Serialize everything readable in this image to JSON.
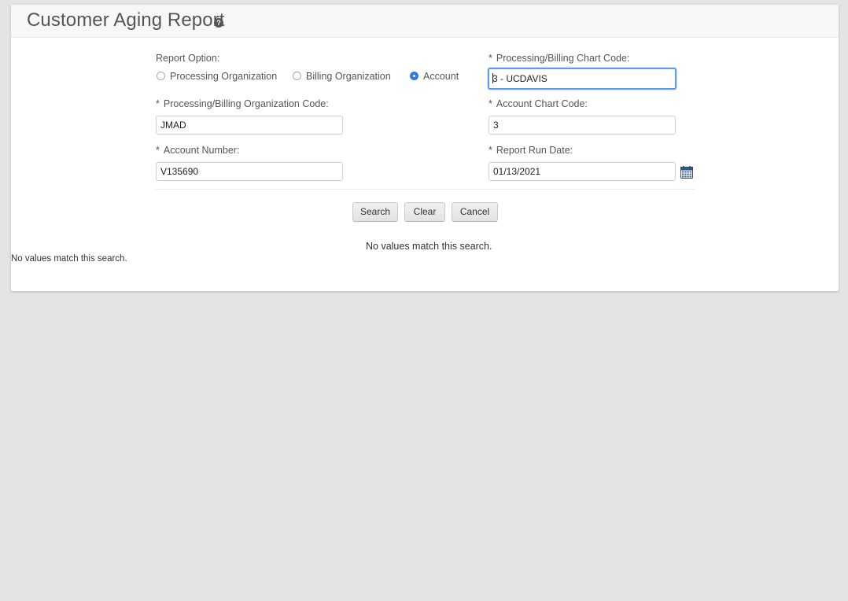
{
  "header": {
    "title": "Customer Aging Report",
    "help_icon": "help-icon",
    "help_glyph": "?"
  },
  "report_option": {
    "label": "Report Option:",
    "options": [
      {
        "label": "Processing Organization",
        "checked": false
      },
      {
        "label": "Billing Organization",
        "checked": false
      },
      {
        "label": "Account",
        "checked": true
      }
    ]
  },
  "fields": {
    "required_marker": "*",
    "processing_chart_code": {
      "label": "Processing/Billing Chart Code:",
      "value": "3 - UCDAVIS"
    },
    "processing_org_code": {
      "label": "Processing/Billing Organization Code:",
      "value": "JMAD"
    },
    "account_chart_code": {
      "label": "Account Chart Code:",
      "value": "3"
    },
    "account_number": {
      "label": "Account Number:",
      "value": "V135690"
    },
    "report_run_date": {
      "label": "Report Run Date:",
      "value": "01/13/2021",
      "icon": "calendar-icon"
    }
  },
  "buttons": {
    "search": "Search",
    "clear": "Clear",
    "cancel": "Cancel"
  },
  "messages": {
    "center": "No values match this search.",
    "left": "No values match this search."
  },
  "colors": {
    "background": "#e4e4e4",
    "focus_border": "#5b9be8",
    "radio_checked": "#2f7ae5"
  }
}
